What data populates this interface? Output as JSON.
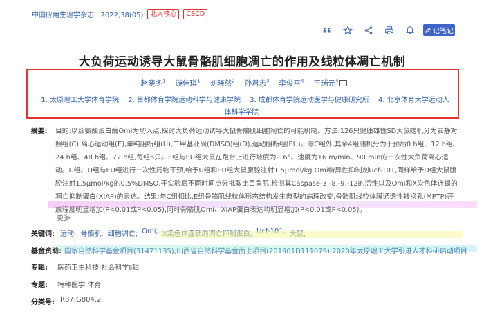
{
  "header": {
    "journal": "中国应用生理学杂志 . 2022,38(05)",
    "tags": [
      "北大核心",
      "CSCD"
    ]
  },
  "toolbar": {
    "note_label": "记笔记",
    "icons": [
      "quote-icon",
      "star-icon",
      "share-icon",
      "print-icon",
      "bell-icon"
    ]
  },
  "title": "大负荷运动诱导大鼠骨骼肌细胞凋亡的作用及线粒体凋亡机制",
  "authors": [
    {
      "name": "赵晓冬",
      "sup": "1"
    },
    {
      "name": "游佳琪",
      "sup": "1"
    },
    {
      "name": "刘晓然",
      "sup": "2"
    },
    {
      "name": "孙君志",
      "sup": "3"
    },
    {
      "name": "李俊平",
      "sup": "4"
    },
    {
      "name": "王瑞元",
      "sup": "4"
    }
  ],
  "affiliations": [
    "1. 太原理工大学体育学院",
    "2. 首都体育学院运动科学与健康学院",
    "3. 成都体育学院运动医学与健康研究所",
    "4. 北京体育大学运动人体科学学院"
  ],
  "abstract": {
    "label": "摘要:",
    "text": "目的:以丝氨酸蛋白酶Omi为切入点,探讨大负荷运动诱导大鼠骨骼肌细胞凋亡的可能机制。方法:126只健康雄性SD大鼠随机分为安静对照组(C),离心运动组(E),单纯阻断组(U),二甲基亚砜(DMSO)组(D),运动阻断组(EU)。除C组外,其余4组随机分为于预后0 h组、12 h组、24 h组、48 h组、72 h组,每组6只。E组与EU组大鼠在跑台上进行坡度为-16°、速度为16 m/min、90 min的一次性大负荷离心运动。U组、D组与EU组进行一次性药物干预,给予U组和EU组大鼠腹腔注射1.5μmol/kg Omi特异性抑制剂Ucf-101,同样给予D组大鼠腹腔注射1.5μmol/kg的0.5%DMSO,于实验后不同时间点分批取比目鱼肌,检测其Caspase-3,-8,-9,-12的活性以及Omi和X染色体连锁的凋亡抑制蛋白(XIAP)的表达。结果:与C组相比,E组骨骼肌线粒体形态结构发生典型的病理改变,骨骼肌线粒体膜通透性转换孔(MPTP)开放程度明显增加(P<0.01或P<0.05),同时骨骼肌Omi、XIAP蛋白表达均明显增加(P<0.01或P<0.05)。",
    "more": "更多"
  },
  "keywords": {
    "label": "关键词:",
    "items": [
      "运动;",
      "骨骼肌;",
      "细胞凋亡;",
      "Omi;",
      "X染色体连锁的凋亡抑制蛋白;",
      "Ucf-101;",
      "大鼠;"
    ]
  },
  "fund": {
    "label": "基金资助:",
    "text": "国家自然科学基金项目(31471135);山西省自然科学基金面上项目(201901D111079);2020年太原理工大学引进人才科研启动项目"
  },
  "album": {
    "label": "专辑:",
    "text": "医药卫生科技;社会科学Ⅱ辑"
  },
  "topic": {
    "label": "专题:",
    "text": "特种医学;体育"
  },
  "classification": {
    "label": "分类号:",
    "text": "R87;G804.2"
  }
}
